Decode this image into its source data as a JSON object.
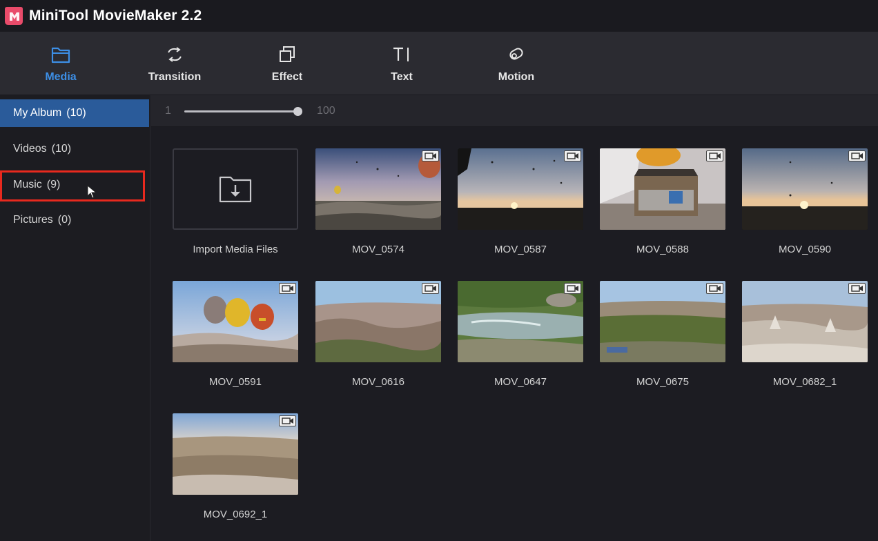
{
  "app": {
    "title": "MiniTool MovieMaker 2.2"
  },
  "toolbar": {
    "tabs": [
      {
        "label": "Media",
        "icon": "folder-icon",
        "active": true
      },
      {
        "label": "Transition",
        "icon": "transition-icon",
        "active": false
      },
      {
        "label": "Effect",
        "icon": "effect-icon",
        "active": false
      },
      {
        "label": "Text",
        "icon": "text-icon",
        "active": false
      },
      {
        "label": "Motion",
        "icon": "motion-icon",
        "active": false
      }
    ]
  },
  "sidebar": {
    "items": [
      {
        "label": "My Album",
        "count": "(10)",
        "active": true
      },
      {
        "label": "Videos",
        "count": "(10)",
        "active": false
      },
      {
        "label": "Music",
        "count": "(9)",
        "active": false,
        "highlighted": true
      },
      {
        "label": "Pictures",
        "count": "(0)",
        "active": false
      }
    ]
  },
  "zoom": {
    "min": "1",
    "max": "100",
    "value": 100
  },
  "media": {
    "import_label": "Import Media Files",
    "items": [
      {
        "name": "MOV_0574",
        "type": "video"
      },
      {
        "name": "MOV_0587",
        "type": "video"
      },
      {
        "name": "MOV_0588",
        "type": "video"
      },
      {
        "name": "MOV_0590",
        "type": "video"
      },
      {
        "name": "MOV_0591",
        "type": "video"
      },
      {
        "name": "MOV_0616",
        "type": "video"
      },
      {
        "name": "MOV_0647",
        "type": "video"
      },
      {
        "name": "MOV_0675",
        "type": "video"
      },
      {
        "name": "MOV_0682_1",
        "type": "video"
      },
      {
        "name": "MOV_0692_1",
        "type": "video"
      }
    ]
  },
  "colors": {
    "accent": "#3d8fe6",
    "selected": "#2a5b9a",
    "highlight": "#e8291e",
    "logo": "#e94b6a"
  }
}
